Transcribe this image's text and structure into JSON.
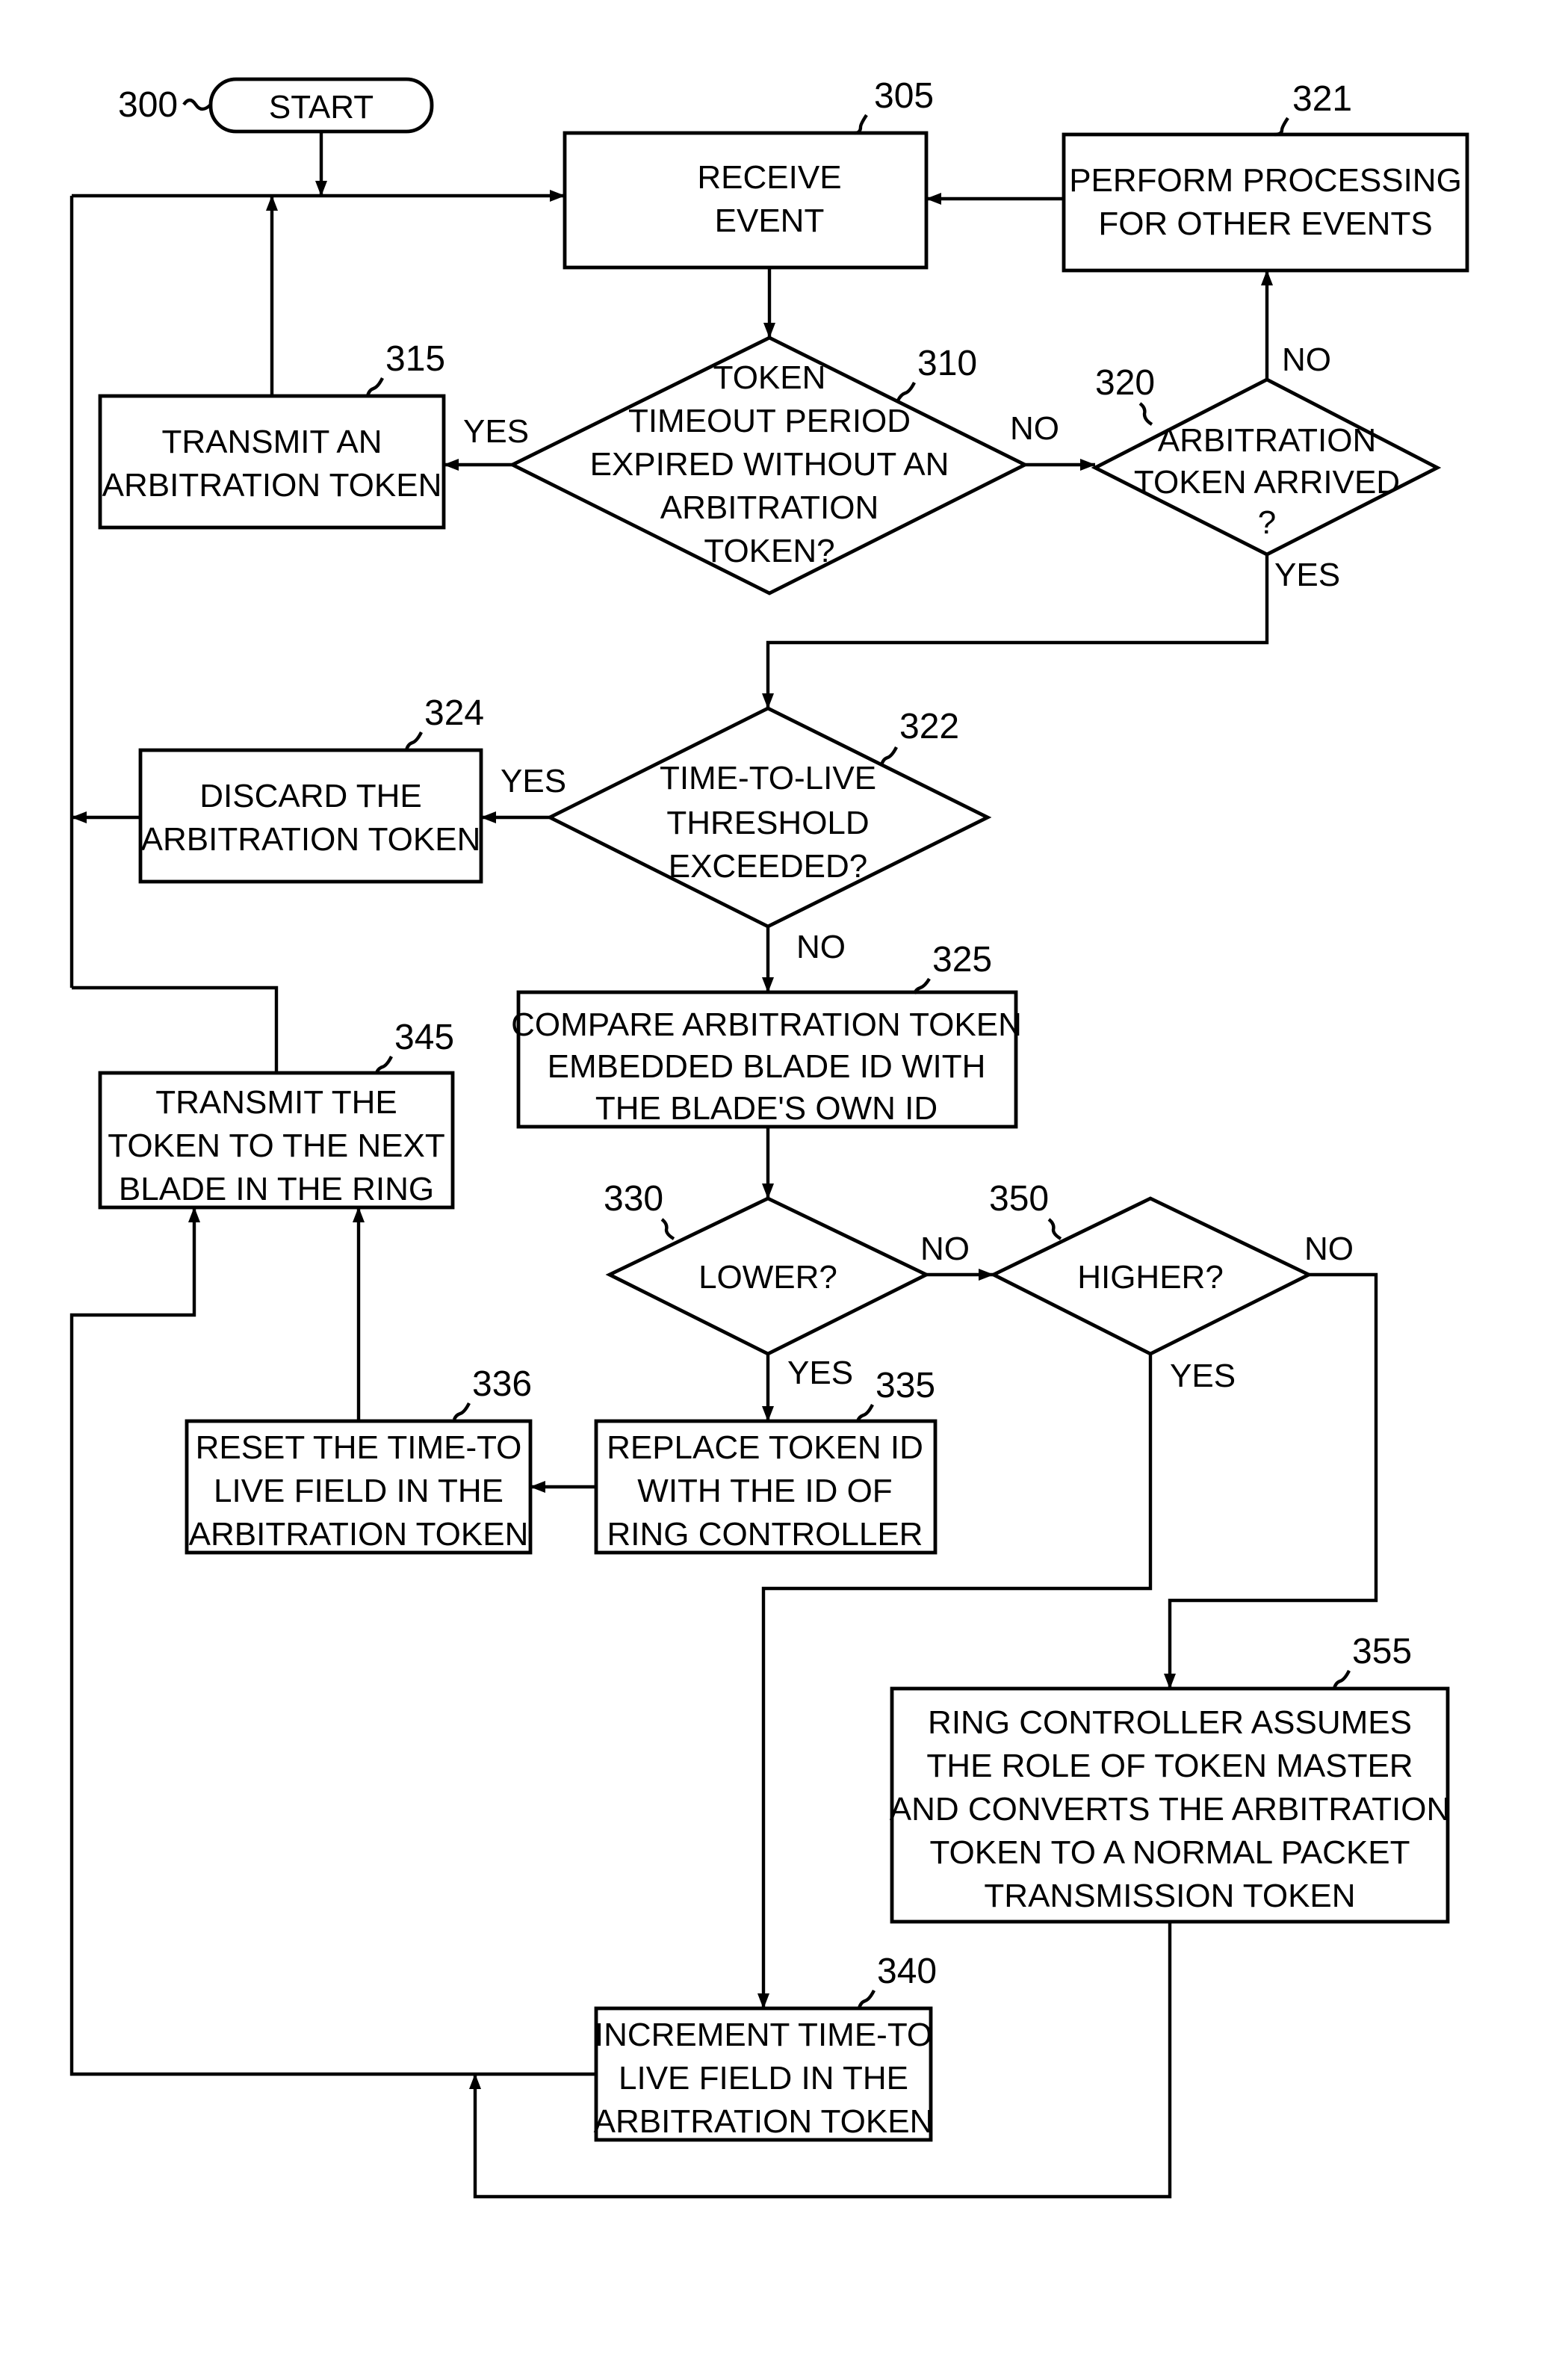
{
  "figure": {
    "start": {
      "ref": "300",
      "label": "START"
    },
    "nodes": {
      "n305": {
        "ref": "305",
        "lines": [
          "RECEIVE",
          "EVENT"
        ]
      },
      "n310": {
        "ref": "310",
        "lines": [
          "TOKEN",
          "TIMEOUT PERIOD",
          "EXPIRED WITHOUT AN",
          "ARBITRATION",
          "TOKEN?"
        ]
      },
      "n315": {
        "ref": "315",
        "lines": [
          "TRANSMIT AN",
          "ARBITRATION TOKEN"
        ]
      },
      "n320": {
        "ref": "320",
        "lines": [
          "ARBITRATION",
          "TOKEN ARRIVED",
          "?"
        ]
      },
      "n321": {
        "ref": "321",
        "lines": [
          "PERFORM PROCESSING",
          "FOR OTHER EVENTS"
        ]
      },
      "n322": {
        "ref": "322",
        "lines": [
          "TIME-TO-LIVE",
          "THRESHOLD",
          "EXCEEDED?"
        ]
      },
      "n324": {
        "ref": "324",
        "lines": [
          "DISCARD THE",
          "ARBITRATION TOKEN"
        ]
      },
      "n325": {
        "ref": "325",
        "lines": [
          "COMPARE ARBITRATION TOKEN",
          "EMBEDDED BLADE ID WITH",
          "THE BLADE'S OWN ID"
        ]
      },
      "n330": {
        "ref": "330",
        "lines": [
          "LOWER?"
        ]
      },
      "n335": {
        "ref": "335",
        "lines": [
          "REPLACE TOKEN ID",
          "WITH THE ID OF",
          "RING CONTROLLER"
        ]
      },
      "n336": {
        "ref": "336",
        "lines": [
          "RESET THE TIME-TO",
          "LIVE FIELD IN THE",
          "ARBITRATION TOKEN"
        ]
      },
      "n340": {
        "ref": "340",
        "lines": [
          "INCREMENT TIME-TO",
          "LIVE FIELD IN THE",
          "ARBITRATION TOKEN"
        ]
      },
      "n345": {
        "ref": "345",
        "lines": [
          "TRANSMIT THE",
          "TOKEN TO THE NEXT",
          "BLADE IN THE RING"
        ]
      },
      "n350": {
        "ref": "350",
        "lines": [
          "HIGHER?"
        ]
      },
      "n355": {
        "ref": "355",
        "lines": [
          "RING CONTROLLER ASSUMES",
          "THE ROLE OF TOKEN MASTER",
          "AND CONVERTS THE ARBITRATION",
          "TOKEN TO A NORMAL PACKET",
          "TRANSMISSION TOKEN"
        ]
      }
    },
    "edge_labels": {
      "yes": "YES",
      "no": "NO"
    }
  }
}
